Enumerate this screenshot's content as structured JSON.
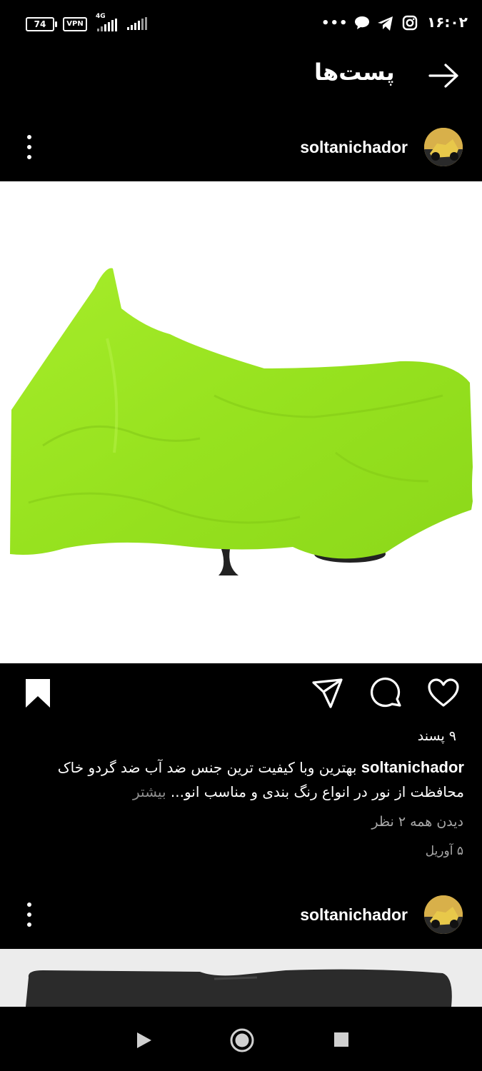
{
  "status_bar": {
    "battery": "74",
    "vpn": "VPN",
    "network": "4G",
    "overflow": "•••",
    "time": "۱۶:۰۲",
    "icons": [
      "battery-icon",
      "vpn-icon",
      "signal-4g-icon",
      "signal-icon",
      "chat-bubble-icon",
      "telegram-icon",
      "instagram-icon"
    ]
  },
  "header": {
    "title": "پست‌ها",
    "back_icon": "arrow-right-icon"
  },
  "posts": [
    {
      "username": "soltanichador",
      "likes": "۹ پسند",
      "caption_user": "soltanichador",
      "caption_text": " بهترین وبا کیفیت ترین جنس ضد آب  ضد گردو خاک  محافظت از نور  در انواع رنگ بندی و مناسب انو...",
      "more": "بیشتر",
      "view_comments": "دیدن همه ۲ نظر",
      "date": "۵ آوریل",
      "image_subject": "motorcycle-cover-lime-green"
    },
    {
      "username": "soltanichador"
    }
  ],
  "actions": [
    "heart-icon",
    "comment-icon",
    "share-icon",
    "bookmark-icon"
  ],
  "colors": {
    "background": "#000000",
    "cover_green": "#9ee625",
    "secondary_text": "#a8a8a8"
  }
}
